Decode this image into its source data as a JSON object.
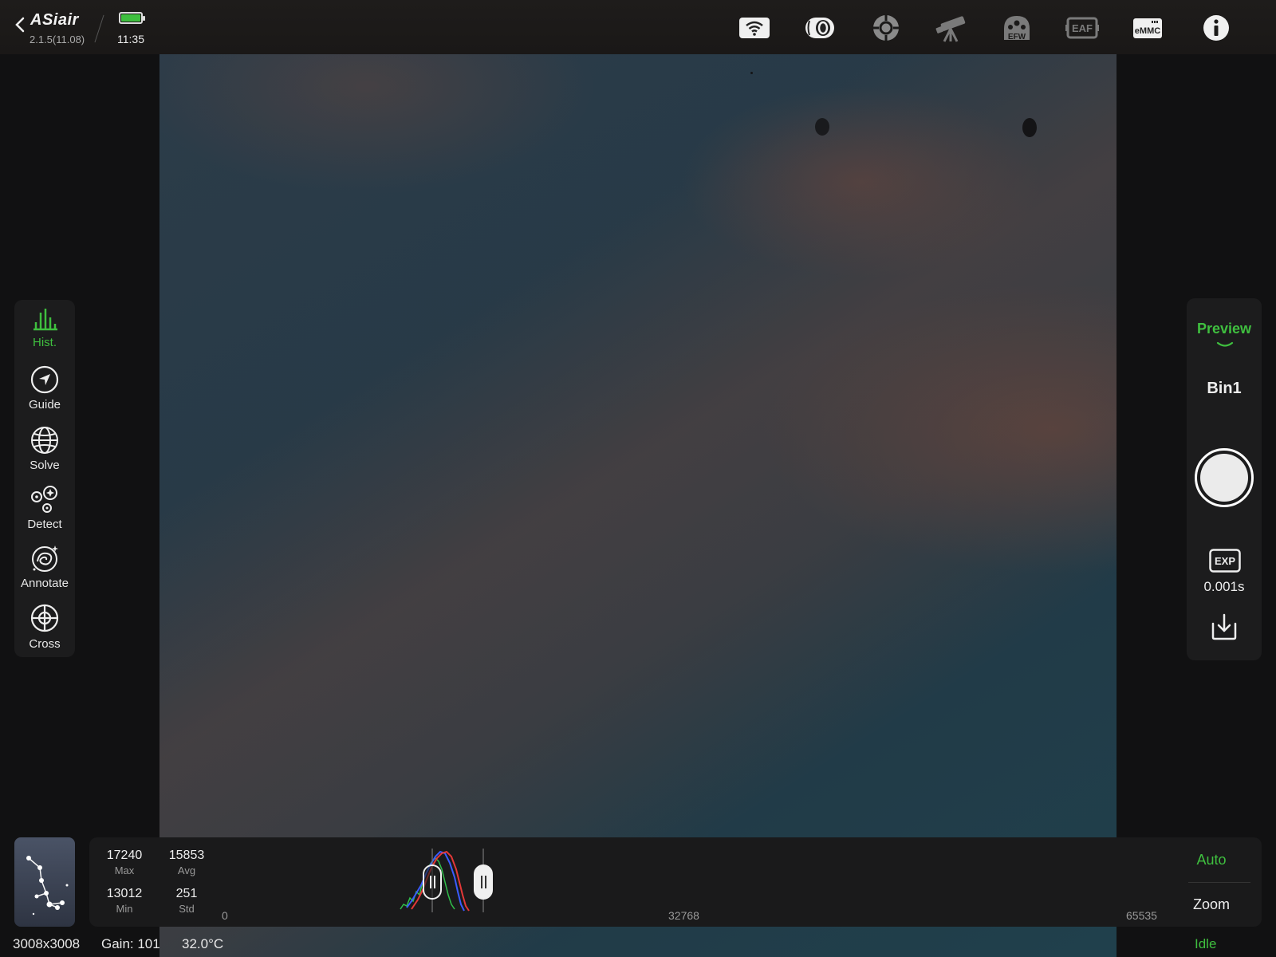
{
  "header": {
    "app_name": "ASiair",
    "version": "2.1.5(11.08)",
    "time": "11:35",
    "battery_color": "#3fbf3f",
    "device_icons": [
      "wifi-icon",
      "camera-icon",
      "guide-scope-icon",
      "telescope-icon",
      "filter-wheel-icon",
      "focuser-icon",
      "emmc-icon",
      "info-icon"
    ],
    "efw_label": "EFW",
    "eaf_label": "EAF",
    "emmc_label": "eMMC"
  },
  "tools": [
    {
      "label": "Hist.",
      "icon": "histogram-icon",
      "active": true
    },
    {
      "label": "Guide",
      "icon": "guide-icon",
      "active": false
    },
    {
      "label": "Solve",
      "icon": "globe-icon",
      "active": false
    },
    {
      "label": "Detect",
      "icon": "detect-icon",
      "active": false
    },
    {
      "label": "Annotate",
      "icon": "galaxy-icon",
      "active": false
    },
    {
      "label": "Cross",
      "icon": "crosshair-icon",
      "active": false
    }
  ],
  "capture": {
    "mode": "Preview",
    "bin": "Bin1",
    "exp_label": "EXP",
    "exposure": "0.001s"
  },
  "histogram": {
    "stats": {
      "max": {
        "value": "17240",
        "label": "Max"
      },
      "avg": {
        "value": "15853",
        "label": "Avg"
      },
      "min": {
        "value": "13012",
        "label": "Min"
      },
      "std": {
        "value": "251",
        "label": "Std"
      }
    },
    "axis": {
      "min": "0",
      "mid": "32768",
      "max": "65535"
    },
    "auto_label": "Auto",
    "zoom_label": "Zoom"
  },
  "status": {
    "resolution": "3008x3008",
    "gain": "Gain: 101",
    "temperature": "32.0°C",
    "state": "Idle"
  },
  "colors": {
    "accent": "#3fbf3f",
    "panel": "#1c1c1d"
  }
}
